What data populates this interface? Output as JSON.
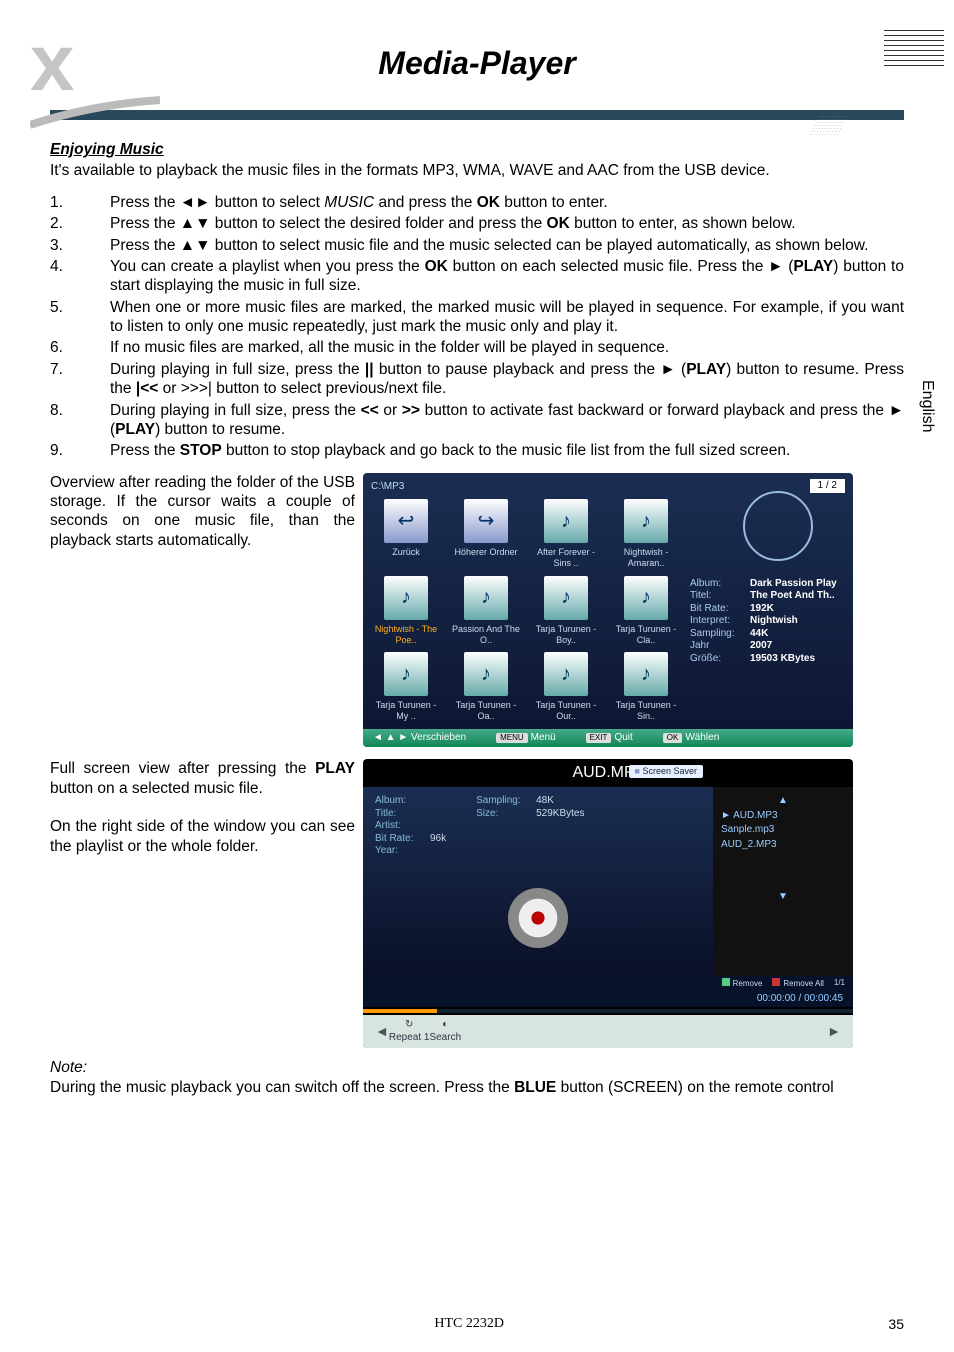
{
  "lang_tab": "English",
  "title": "Media-Player",
  "brand_letter": "x",
  "section_heading": "Enjoying Music",
  "intro": "It's available to playback the music files in the formats MP3, WMA, WAVE and AAC from the USB device.",
  "steps": [
    "Press the ◄► button to select MUSIC and press the OK button to enter.",
    "Press the ▲▼ button to select the desired folder and press the OK button to enter, as shown below.",
    "Press the ▲▼ button to select music file and the music selected can be played automatically, as shown below.",
    "You can create a playlist when you press the OK button on each selected music file. Press the ► (PLAY) button to start displaying the music in full size.",
    "When one or more music files are marked, the marked music will be played in sequence. For example, if you want to listen to only one music repeatedly, just mark the music only and play it.",
    "If no music files are marked, all the music in the folder will be played in sequence.",
    "During playing in full size, press the || button to pause playback and press the ► (PLAY) button to resume. Press the |<< or >>|  button to select previous/next file.",
    "During playing in full size, press the << or >> button to activate fast backward or forward playback and press the ► (PLAY) button to resume.",
    "Press the STOP button to stop playback and go back to the music file list from the full sized screen."
  ],
  "overview_text": "Overview after reading the folder of the USB storage. If the cursor waits a couple of seconds on one music file, than the playback starts automatically.",
  "full_text_1": "Full screen view after pressing the PLAY button on a selected music file.",
  "full_text_2": "On the right side of the window you can see the playlist or the whole folder.",
  "note_label": "Note:",
  "note_text": "During the music playback you can switch off the screen. Press the BLUE button (SCREEN) on the remote control",
  "footer_model": "HTC 2232D",
  "footer_page": "35",
  "scr1": {
    "path": "C:\\MP3",
    "counter": "1 / 2",
    "row1": [
      {
        "label": "Zurück",
        "glyph": "↩",
        "cls": "back"
      },
      {
        "label": "Höherer Ordner",
        "glyph": "↪",
        "cls": "back"
      },
      {
        "label": "After Forever - Sins ..",
        "glyph": "♪",
        "cls": ""
      },
      {
        "label": "Nightwish - Amaran..",
        "glyph": "♪",
        "cls": ""
      }
    ],
    "row2": [
      {
        "label": "Nightwish - The Poe..",
        "glyph": "♪",
        "cls": "",
        "hl": true
      },
      {
        "label": "Passion And The O..",
        "glyph": "♪",
        "cls": ""
      },
      {
        "label": "Tarja Turunen - Boy..",
        "glyph": "♪",
        "cls": ""
      },
      {
        "label": "Tarja Turunen - Cla..",
        "glyph": "♪",
        "cls": ""
      }
    ],
    "row3": [
      {
        "label": "Tarja Turunen - My ..",
        "glyph": "♪",
        "cls": ""
      },
      {
        "label": "Tarja Turunen - Oa..",
        "glyph": "♪",
        "cls": ""
      },
      {
        "label": "Tarja Turunen - Our..",
        "glyph": "♪",
        "cls": ""
      },
      {
        "label": "Tarja Turunen - Sin..",
        "glyph": "♪",
        "cls": ""
      }
    ],
    "info": [
      {
        "k": "Album:",
        "v": "Dark Passion Play"
      },
      {
        "k": "Titel:",
        "v": "The Poet And Th.."
      },
      {
        "k": "Bit Rate:",
        "v": "192K"
      },
      {
        "k": "Interpret:",
        "v": "Nightwish"
      },
      {
        "k": "Sampling:",
        "v": "44K"
      },
      {
        "k": "Jahr",
        "v": "2007"
      },
      {
        "k": "Größe:",
        "v": "19503 KBytes"
      }
    ],
    "bar": {
      "move": "◄ ▲ ► Verschieben",
      "menu": "Menü",
      "quit": "Quit",
      "select": "Wählen"
    }
  },
  "scr2": {
    "title": "AUD.MP3",
    "ssaver": "Screen Saver",
    "left_info": [
      {
        "k": "Album:",
        "v": ""
      },
      {
        "k": "Title:",
        "v": ""
      },
      {
        "k": "Artist:",
        "v": ""
      },
      {
        "k": "Bit Rate:",
        "v": "96k"
      },
      {
        "k": "Year:",
        "v": ""
      }
    ],
    "left_info2": [
      {
        "k": "Sampling:",
        "v": "48K"
      },
      {
        "k": "Size:",
        "v": "529KBytes"
      }
    ],
    "playlist": [
      "AUD.MP3",
      "Sanple.mp3",
      "AUD_2.MP3"
    ],
    "remove": "Remove",
    "remove_all": "Remove All",
    "remove_count": "1/1",
    "time": "00:00:00 / 00:00:45",
    "repeat": "Repeat 1",
    "search": "Search"
  }
}
